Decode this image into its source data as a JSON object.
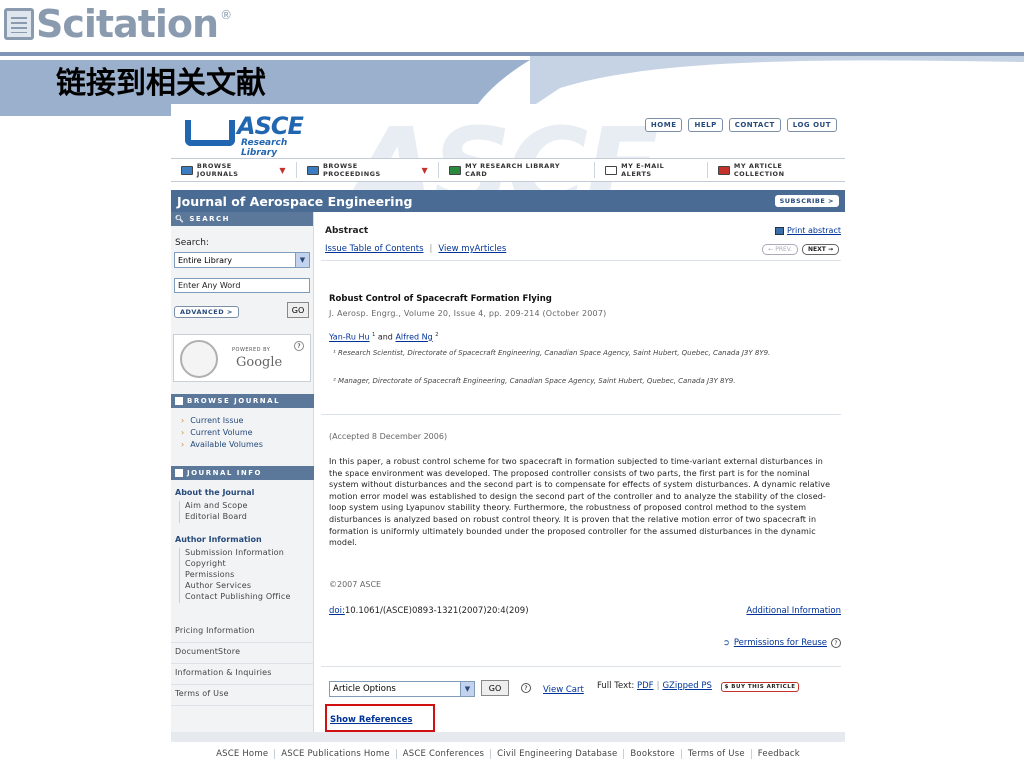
{
  "slide": {
    "logo_text": "Scitation",
    "logo_reg": "®",
    "title": "链接到相关文献"
  },
  "colors": {
    "journal_bar": "#4a6c94",
    "sidebar_head": "#5b7799",
    "link": "#003399",
    "highlight_box": "#d01010"
  },
  "site": {
    "logo_name": "ASCE",
    "logo_sub": "Research Library",
    "top_links": [
      "HOME",
      "HELP",
      "CONTACT",
      "LOG OUT"
    ],
    "nav": [
      {
        "label": "BROWSE JOURNALS",
        "icon": "journal-icon",
        "caret": true
      },
      {
        "label": "BROWSE PROCEEDINGS",
        "icon": "proceedings-icon",
        "caret": true
      },
      {
        "label": "MY RESEARCH LIBRARY CARD",
        "icon": "card-icon",
        "caret": false
      },
      {
        "label": "MY E-MAIL ALERTS",
        "icon": "mail-icon",
        "caret": false
      },
      {
        "label": "MY ARTICLE COLLECTION",
        "icon": "collection-icon",
        "caret": false
      }
    ],
    "journal_title": "Journal of Aerospace Engineering",
    "subscribe": "SUBSCRIBE >"
  },
  "sidebar": {
    "search_head": "SEARCH",
    "search_label": "Search:",
    "search_select": "Entire Library",
    "word_placeholder": "Enter Any Word",
    "advanced": "ADVANCED  >",
    "go": "GO",
    "powered_by": "POWERED BY",
    "google": "Google",
    "browse_head": "BROWSE JOURNAL",
    "browse_items": [
      "Current Issue",
      "Current Volume",
      "Available Volumes"
    ],
    "info_head": "JOURNAL INFO",
    "about_title": "About the Journal",
    "about_items": [
      "Aim and Scope",
      "Editorial Board"
    ],
    "author_title": "Author Information",
    "author_items": [
      "Submission Information",
      "Copyright",
      "Permissions",
      "Author Services",
      "Contact Publishing Office"
    ],
    "extra_links": [
      "Pricing Information",
      "DocumentStore",
      "Information & Inquiries",
      "Terms of Use"
    ]
  },
  "main": {
    "abstract_label": "Abstract",
    "print_abstract": "Print abstract",
    "toc": "Issue Table of Contents",
    "my_articles": "View myArticles",
    "prev": "← PREV.",
    "next": "NEXT →",
    "article_title": "Robust Control of Spacecraft Formation Flying",
    "citation": "J. Aerosp. Engrg., Volume 20, Issue 4, pp. 209-214 (October 2007)",
    "author1": "Yan-Ru Hu",
    "author1_sup": "1",
    "and": "and",
    "author2": "Alfred Ng",
    "author2_sup": "2",
    "affil1": "¹ Research Scientist, Directorate of Spacecraft Engineering, Canadian Space Agency, Saint Hubert, Quebec, Canada J3Y 8Y9.",
    "affil2": "² Manager, Directorate of Spacecraft Engineering, Canadian Space Agency, Saint Hubert, Quebec, Canada J3Y 8Y9.",
    "accepted": "(Accepted 8 December 2006)",
    "abstract": "In this paper, a robust control scheme for two spacecraft in formation subjected to time-variant external disturbances in the space environment was developed. The proposed controller consists of two parts, the first part is for the nominal system without disturbances and the second part is to compensate for effects of system disturbances. A dynamic relative motion error model was established to design the second part of the controller and to analyze the stability of the closed-loop system using Lyapunov stability theory. Furthermore, the robustness of proposed control method to the system disturbances is analyzed based on robust control theory. It is proven that the relative motion error of two spacecraft in formation is uniformly ultimately bounded under the proposed controller for the assumed disturbances in the dynamic model.",
    "copyright": "©2007 ASCE",
    "doi_label": "doi:",
    "doi_value": "10.1061/(ASCE)0893-1321(2007)20:4(209)",
    "additional_info": "Additional Information",
    "permissions": "Permissions for Reuse",
    "article_options": "Article Options",
    "go": "GO",
    "view_cart": "View Cart",
    "full_text": "Full Text:",
    "pdf": "PDF",
    "gzipped": "GZipped PS",
    "buy": "$ BUY THIS ARTICLE",
    "show_references": "Show References"
  },
  "footer": [
    "ASCE Home",
    "ASCE Publications Home",
    "ASCE Conferences",
    "Civil Engineering Database",
    "Bookstore",
    "Terms of Use",
    "Feedback"
  ]
}
